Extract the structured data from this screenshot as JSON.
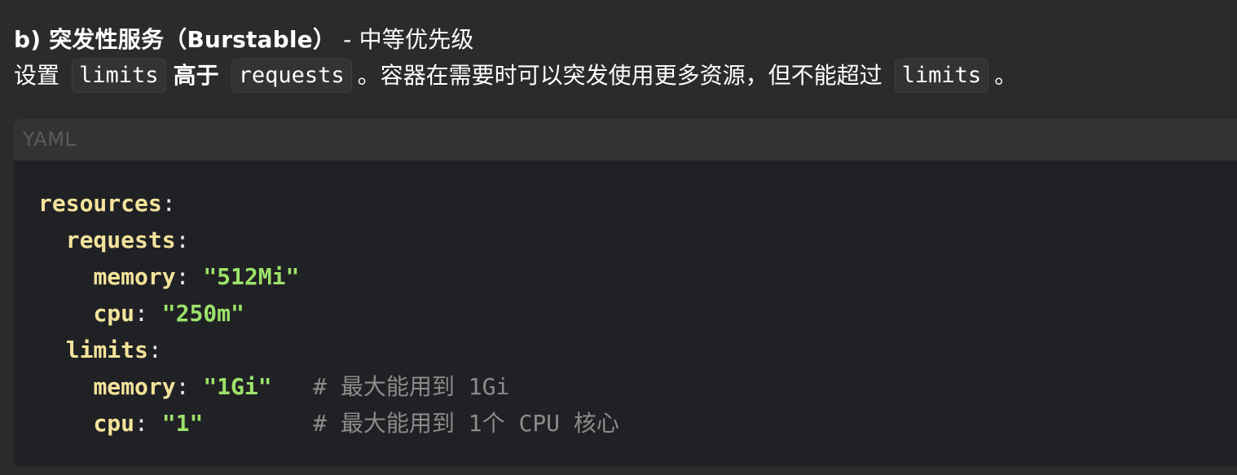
{
  "heading": {
    "main": "b) 突发性服务（Burstable）",
    "suffix": " - 中等优先级"
  },
  "description": {
    "text1": "设置",
    "code1": "limits",
    "bold": "高于",
    "code2": "requests",
    "text2": "。容器在需要时可以突发使用更多资源，但不能超过",
    "code3": "limits",
    "text3": "。"
  },
  "code_block": {
    "language": "YAML",
    "lines": [
      {
        "indent": "",
        "key": "resources",
        "punc": ":",
        "value": "",
        "comment": ""
      },
      {
        "indent": "  ",
        "key": "requests",
        "punc": ":",
        "value": "",
        "comment": ""
      },
      {
        "indent": "    ",
        "key": "memory",
        "punc": ": ",
        "value": "\"512Mi\"",
        "comment": ""
      },
      {
        "indent": "    ",
        "key": "cpu",
        "punc": ": ",
        "value": "\"250m\"",
        "comment": ""
      },
      {
        "indent": "  ",
        "key": "limits",
        "punc": ":",
        "value": "",
        "comment": ""
      },
      {
        "indent": "    ",
        "key": "memory",
        "punc": ": ",
        "value": "\"1Gi\"",
        "comment": "   # 最大能用到 1Gi"
      },
      {
        "indent": "    ",
        "key": "cpu",
        "punc": ": ",
        "value": "\"1\"",
        "comment": "        # 最大能用到 1个 CPU 核心"
      }
    ]
  },
  "colors": {
    "page_bg": "#2b2b2b",
    "code_bg": "#202124",
    "code_header_bg": "#333335",
    "yaml_key": "#f3e39b",
    "yaml_string": "#9ce36a",
    "yaml_comment": "#8b8b8b"
  }
}
